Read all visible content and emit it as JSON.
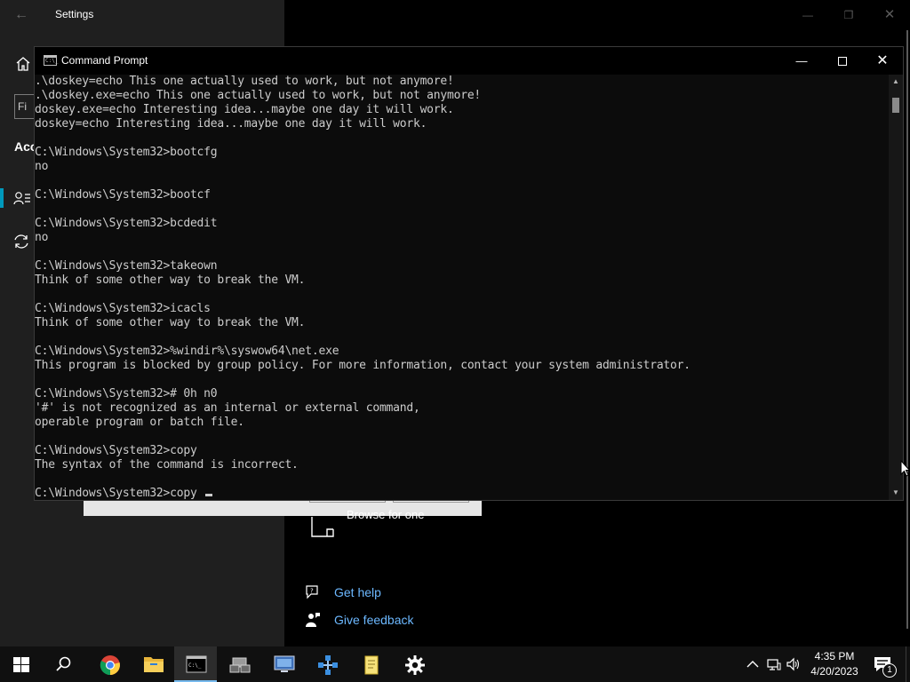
{
  "settings": {
    "title": "Settings",
    "find_placeholder": "Fi",
    "section_heading": "Acc",
    "browse_label": "Browse for one",
    "help_links": [
      "Get help",
      "Give feedback"
    ]
  },
  "cmd": {
    "title": "Command Prompt",
    "icon_text": "C:\\_",
    "lines": [
      ".\\doskey=echo This one actually used to work, but not anymore!",
      ".\\doskey.exe=echo This one actually used to work, but not anymore!",
      "doskey.exe=echo Interesting idea...maybe one day it will work.",
      "doskey=echo Interesting idea...maybe one day it will work.",
      "",
      "C:\\Windows\\System32>bootcfg",
      "no",
      "",
      "C:\\Windows\\System32>bootcf",
      "",
      "C:\\Windows\\System32>bcdedit",
      "no",
      "",
      "C:\\Windows\\System32>takeown",
      "Think of some other way to break the VM.",
      "",
      "C:\\Windows\\System32>icacls",
      "Think of some other way to break the VM.",
      "",
      "C:\\Windows\\System32>%windir%\\syswow64\\net.exe",
      "This program is blocked by group policy. For more information, contact your system administrator.",
      "",
      "C:\\Windows\\System32># 0h n0",
      "'#' is not recognized as an internal or external command,",
      "operable program or batch file.",
      "",
      "C:\\Windows\\System32>copy",
      "The syntax of the command is incorrect.",
      ""
    ],
    "prompt_line": "C:\\Windows\\System32>copy "
  },
  "taskbar": {
    "apps": [
      {
        "name": "start-button",
        "icon": "windows-logo"
      },
      {
        "name": "search-button",
        "icon": "search-icon"
      },
      {
        "name": "chrome",
        "icon": "chrome-icon"
      },
      {
        "name": "file-explorer",
        "icon": "folder-icon"
      },
      {
        "name": "command-prompt",
        "icon": "cmd-icon",
        "active": true
      },
      {
        "name": "network-app",
        "icon": "server-icon"
      },
      {
        "name": "remote-desktop",
        "icon": "monitor-icon"
      },
      {
        "name": "network-settings",
        "icon": "network-icon"
      },
      {
        "name": "notepad",
        "icon": "notepad-icon"
      },
      {
        "name": "settings",
        "icon": "gear-icon"
      }
    ],
    "time": "4:35 PM",
    "date": "4/20/2023",
    "notification_count": "1"
  },
  "colors": {
    "console_bg": "#0c0c0c",
    "console_text": "#cccccc",
    "accent": "#0099bc",
    "link": "#6cb8ff",
    "taskbar": "#101010"
  }
}
